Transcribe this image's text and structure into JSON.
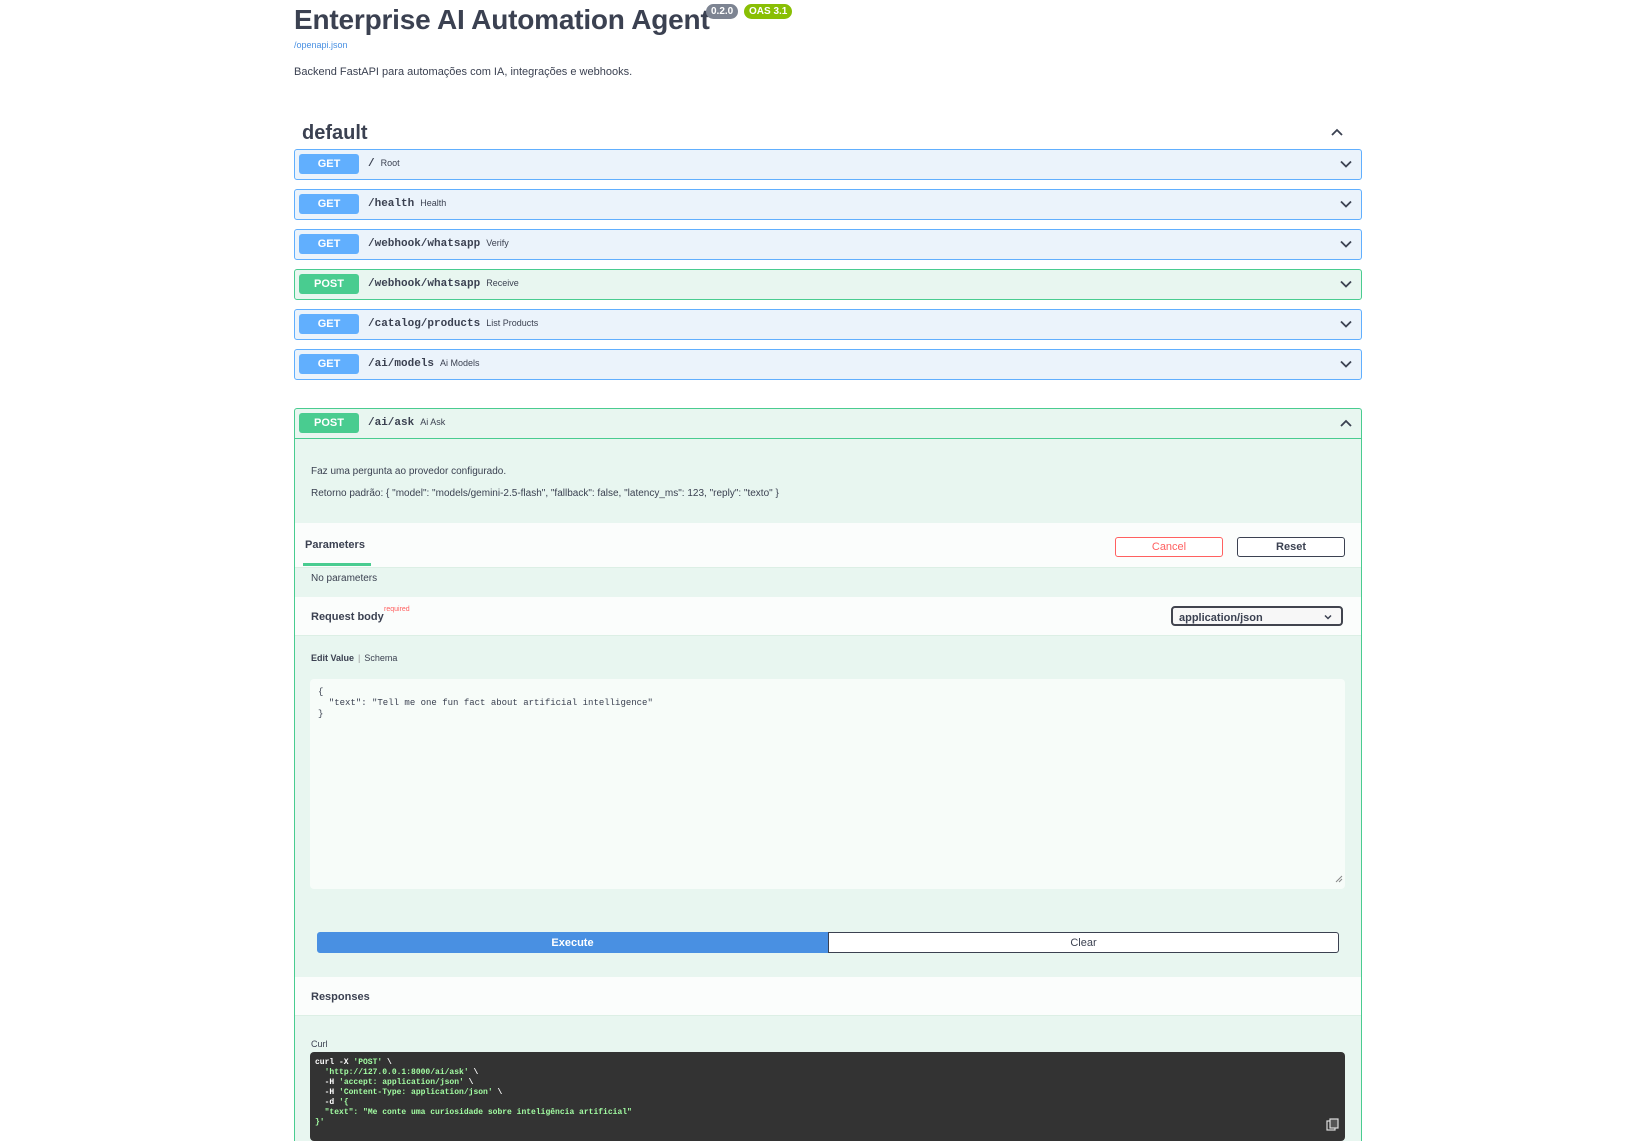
{
  "header": {
    "title": "Enterprise AI Automation Agent",
    "version_badge": "0.2.0",
    "oas_badge": "OAS 3.1",
    "openapi_link": "/openapi.json",
    "description": "Backend FastAPI para automações com IA, integrações e webhooks."
  },
  "tag": {
    "name": "default"
  },
  "operations": [
    {
      "method": "GET",
      "path": "/",
      "summary": "Root"
    },
    {
      "method": "GET",
      "path": "/health",
      "summary": "Health"
    },
    {
      "method": "GET",
      "path": "/webhook/whatsapp",
      "summary": "Verify"
    },
    {
      "method": "POST",
      "path": "/webhook/whatsapp",
      "summary": "Receive"
    },
    {
      "method": "GET",
      "path": "/catalog/products",
      "summary": "List Products"
    },
    {
      "method": "GET",
      "path": "/ai/models",
      "summary": "Ai Models"
    }
  ],
  "expanded": {
    "method": "POST",
    "path": "/ai/ask",
    "summary": "Ai Ask",
    "description_line1": "Faz uma pergunta ao provedor configurado.",
    "description_line2": "Retorno padrão: { \"model\": \"models/gemini-2.5-flash\", \"fallback\": false, \"latency_ms\": 123, \"reply\": \"texto\" }",
    "parameters_tab": "Parameters",
    "cancel_label": "Cancel",
    "reset_label": "Reset",
    "no_parameters": "No parameters",
    "request_body_label": "Request body",
    "required_label": "required",
    "content_type": "application/json",
    "edit_value_label": "Edit Value",
    "schema_label": "Schema",
    "body_value": "{\n  \"text\": \"Tell me one fun fact about artificial intelligence\"\n}",
    "execute_label": "Execute",
    "clear_label": "Clear",
    "responses_label": "Responses",
    "curl_label": "Curl",
    "curl_lines": [
      {
        "prefix": "curl -X ",
        "value": "'POST'",
        "suffix": " \\"
      },
      {
        "prefix": "  ",
        "value": "'http://127.0.0.1:8000/ai/ask'",
        "suffix": " \\"
      },
      {
        "prefix": "  -H ",
        "value": "'accept: application/json'",
        "suffix": " \\"
      },
      {
        "prefix": "  -H ",
        "value": "'Content-Type: application/json'",
        "suffix": " \\"
      },
      {
        "prefix": "  -d ",
        "value": "'{",
        "suffix": ""
      },
      {
        "prefix": "  ",
        "value": "\"text\": \"Me conte uma curiosidade sobre inteligência artificial\"",
        "suffix": ""
      },
      {
        "prefix": "",
        "value": "}'",
        "suffix": ""
      }
    ]
  },
  "colors": {
    "get": "#61affe",
    "post": "#49cc90",
    "execute": "#4990e2",
    "cancel": "#ff6060"
  }
}
